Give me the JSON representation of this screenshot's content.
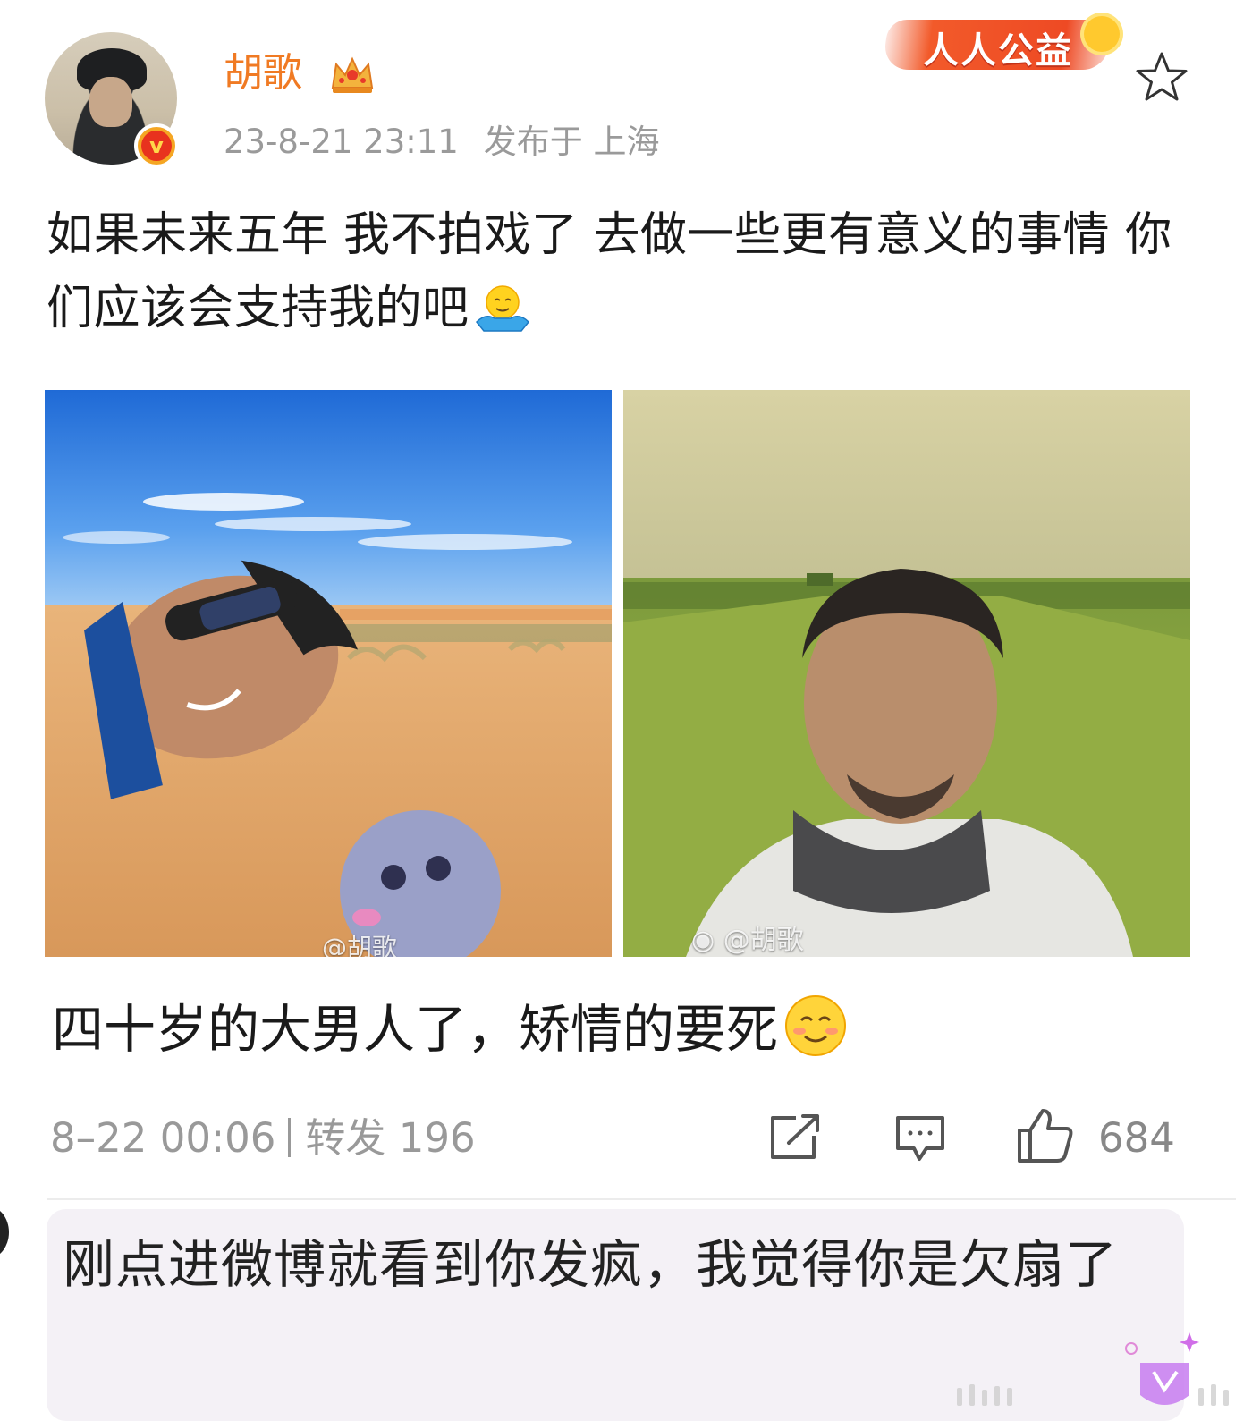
{
  "post": {
    "author": "胡歌",
    "timestamp": "23-8-21 23:11",
    "location": "发布于 上海",
    "badge_label": "人人公益",
    "text": "如果未来五年 我不拍戏了 去做一些更有意义的事情 你们应该会支持我的吧",
    "images": [
      {
        "watermark": "@胡歌"
      },
      {
        "watermark": "@胡歌"
      }
    ]
  },
  "caption": {
    "text": "四十岁的大男人了，矫情的要死"
  },
  "actions": {
    "time": "8–22 00:06",
    "repost_label": "转发 196",
    "like_count": "684"
  },
  "comment": {
    "text": "刚点进微博就看到你发疯，我觉得你是欠扇了"
  },
  "colors": {
    "username": "#f07a23",
    "meta": "#9a9a9a",
    "charity": "#ee4a24"
  }
}
